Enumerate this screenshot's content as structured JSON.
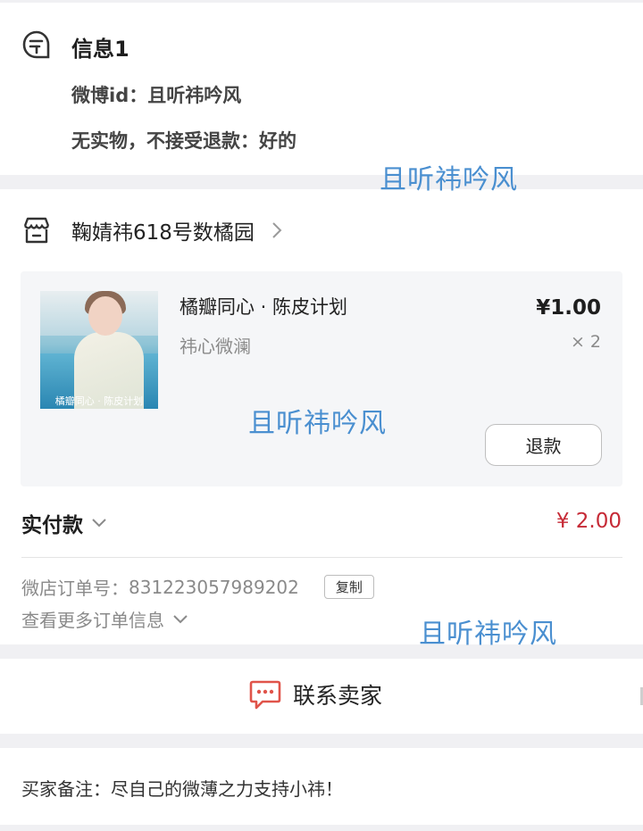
{
  "info": {
    "icon": "message-form-icon",
    "title": "信息1",
    "lines": [
      "微博id：且听祎吟风",
      "无实物，不接受退款：好的"
    ]
  },
  "watermarks": [
    "且听祎吟风",
    "且听祎吟风",
    "且听祎吟风"
  ],
  "shop": {
    "icon": "store-icon",
    "name": "鞠婧祎618号数橘园"
  },
  "item": {
    "image_caption": "橘瓣同心 · 陈皮计划",
    "title": "橘瓣同心 · 陈皮计划",
    "subtitle": "祎心微澜",
    "price": "¥1.00",
    "quantity": "× 2",
    "refund_label": "退款"
  },
  "payment": {
    "label": "实付款",
    "amount": "¥ 2.00"
  },
  "order": {
    "label": "微店订单号：",
    "number": "831223057989202",
    "copy_label": "复制",
    "more_label": "查看更多订单信息"
  },
  "contact": {
    "icon": "chat-bubble-icon",
    "label": "联系卖家"
  },
  "note": {
    "text": "买家备注：尽自己的微薄之力支持小祎！"
  },
  "colors": {
    "accent_price": "#c62a36",
    "watermark": "#4a8fd0",
    "chat_icon": "#e0544a"
  }
}
